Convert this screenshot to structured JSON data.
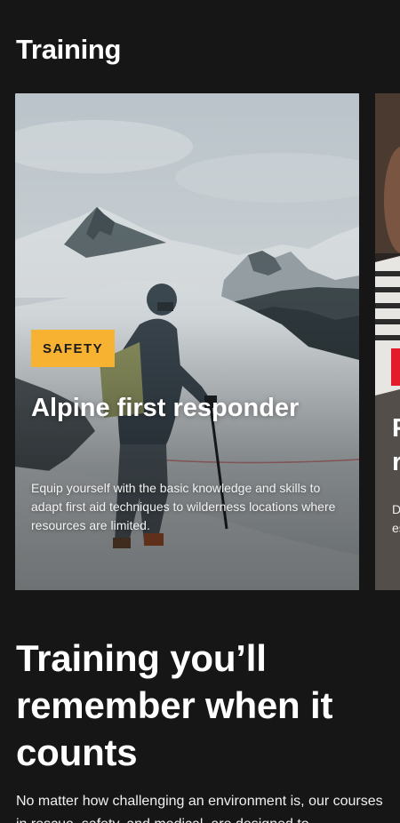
{
  "section": {
    "title": "Training"
  },
  "cards": [
    {
      "badge": "SAFETY",
      "badge_color": "#f6b230",
      "title": "Alpine first responder",
      "description": "Equip yourself with the basic knowledge and skills to adapt first aid techniques to wilderness locations where resources are limited."
    },
    {
      "badge_color": "#e21c2a",
      "title_partial": "F\nr",
      "description_partial": "D\nes"
    }
  ],
  "promo": {
    "headline": "Training you’ll remember when it counts",
    "body": "No matter how challenging an environment is, our courses in rescue, safety, and medical, are designed to"
  }
}
